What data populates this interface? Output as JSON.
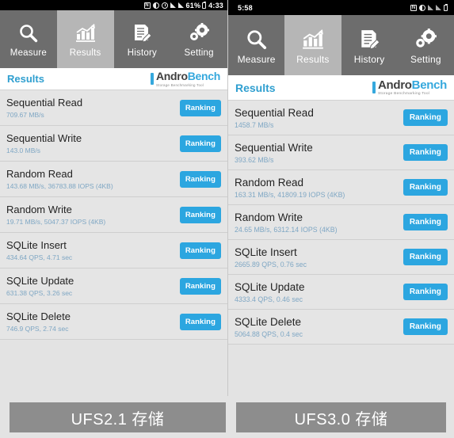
{
  "panels": [
    {
      "id": "left",
      "statusbar": {
        "time": "4:33",
        "battery_pct": "61%",
        "icons": [
          "nfc-icon",
          "vibrate-icon",
          "alarm-clock-icon",
          "signal-icon",
          "signal-icon",
          "battery-icon"
        ]
      },
      "tabs": [
        {
          "label": "Measure",
          "icon": "magnifier-icon",
          "active": false
        },
        {
          "label": "Results",
          "icon": "bar-chart-icon",
          "active": true
        },
        {
          "label": "History",
          "icon": "document-pen-icon",
          "active": false
        },
        {
          "label": "Setting",
          "icon": "gears-icon",
          "active": false
        }
      ],
      "header": {
        "title": "Results",
        "logo_main_a": "Andro",
        "logo_main_b": "Bench",
        "logo_sub": "Storage Benchmarking Tool"
      },
      "rows": [
        {
          "title": "Sequential Read",
          "sub": "709.67 MB/s",
          "button": "Ranking"
        },
        {
          "title": "Sequential Write",
          "sub": "143.0 MB/s",
          "button": "Ranking"
        },
        {
          "title": "Random Read",
          "sub": "143.68 MB/s, 36783.88 IOPS (4KB)",
          "button": "Ranking"
        },
        {
          "title": "Random Write",
          "sub": "19.71 MB/s, 5047.37 IOPS (4KB)",
          "button": "Ranking"
        },
        {
          "title": "SQLite Insert",
          "sub": "434.64 QPS, 4.71 sec",
          "button": "Ranking"
        },
        {
          "title": "SQLite Update",
          "sub": "631.38 QPS, 3.26 sec",
          "button": "Ranking"
        },
        {
          "title": "SQLite Delete",
          "sub": "746.9 QPS, 2.74 sec",
          "button": "Ranking"
        }
      ],
      "caption": "UFS2.1 存储"
    },
    {
      "id": "right",
      "statusbar": {
        "time": "5:58",
        "battery_pct": "",
        "icons": [
          "nfc-icon",
          "vibrate-icon",
          "signal-icon",
          "signal-icon",
          "battery-icon"
        ]
      },
      "tabs": [
        {
          "label": "Measure",
          "icon": "magnifier-icon",
          "active": false
        },
        {
          "label": "Results",
          "icon": "bar-chart-icon",
          "active": true
        },
        {
          "label": "History",
          "icon": "document-pen-icon",
          "active": false
        },
        {
          "label": "Setting",
          "icon": "gears-icon",
          "active": false
        }
      ],
      "header": {
        "title": "Results",
        "logo_main_a": "Andro",
        "logo_main_b": "Bench",
        "logo_sub": "Storage Benchmarking Tool"
      },
      "rows": [
        {
          "title": "Sequential Read",
          "sub": "1458.7 MB/s",
          "button": "Ranking"
        },
        {
          "title": "Sequential Write",
          "sub": "393.62 MB/s",
          "button": "Ranking"
        },
        {
          "title": "Random Read",
          "sub": "163.31 MB/s, 41809.19 IOPS (4KB)",
          "button": "Ranking"
        },
        {
          "title": "Random Write",
          "sub": "24.65 MB/s, 6312.14 IOPS (4KB)",
          "button": "Ranking"
        },
        {
          "title": "SQLite Insert",
          "sub": "2665.89 QPS, 0.76 sec",
          "button": "Ranking"
        },
        {
          "title": "SQLite Update",
          "sub": "4333.4 QPS, 0.46 sec",
          "button": "Ranking"
        },
        {
          "title": "SQLite Delete",
          "sub": "5064.88 QPS, 0.4 sec",
          "button": "Ranking"
        }
      ],
      "caption": "UFS3.0 存储"
    }
  ],
  "colors": {
    "accent": "#2ca6e0",
    "tabbar": "#6d6d6d",
    "tab_active": "#b6b6b6",
    "list_bg": "#e5e5e5",
    "caption_bg": "#8d8d8d",
    "title_text": "#2f9fd0",
    "sub_text": "#7fa7c4"
  }
}
